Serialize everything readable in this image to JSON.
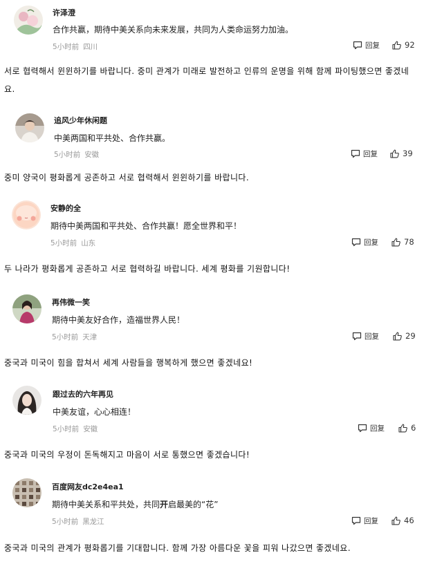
{
  "comments": [
    {
      "username": "许泽澄",
      "text": "合作共赢，期待中美关系向未来发展，共同为人类命运努力加油。",
      "time": "5小时前",
      "location": "四川",
      "reply_label": "回复",
      "likes": "92",
      "translation": "서로 협력해서 윈윈하기를 바랍니다. 중미 관계가 미래로 발전하고 인류의 운명을 위해 함께 파이팅했으면 좋겠네요."
    },
    {
      "username": "追风少年休闲题",
      "text": "中美两国和平共处、合作共赢。",
      "time": "5小时前",
      "location": "安徽",
      "reply_label": "回复",
      "likes": "39",
      "translation": "중미 양국이 평화롭게 공존하고 서로 협력해서 윈윈하기를 바랍니다."
    },
    {
      "username": "安静的全",
      "text": "期待中美两国和平共处、合作共赢！愿全世界和平！",
      "time": "5小时前",
      "location": "山东",
      "reply_label": "回复",
      "likes": "78",
      "translation": "두 나라가 평화롭게 공존하고 서로 협력하길 바랍니다. 세계 평화를 기원합니다!"
    },
    {
      "username": "再伟微一笑",
      "text": "期待中美友好合作，造福世界人民！",
      "time": "5小时前",
      "location": "天津",
      "reply_label": "回复",
      "likes": "29",
      "translation": "중국과 미국이 힘을 합쳐서 세계 사람들을 행복하게 했으면 좋겠네요!"
    },
    {
      "username": "跟过去的六年再见",
      "text": "中美友谊，心心相连！",
      "time": "5小时前",
      "location": "安徽",
      "reply_label": "回复",
      "likes": "6",
      "translation": "중국과 미국의 우정이 돈독해지고 마음이 서로 통했으면 좋겠습니다!"
    },
    {
      "username": "百度网友dc2e4ea1",
      "text_before": "期待中美关系和平共处，共同",
      "text_bold": "开",
      "text_after": "启最美的“花”",
      "time": "5小时前",
      "location": "黑龙江",
      "reply_label": "回复",
      "likes": "46",
      "translation": "중국과 미국의 관계가 평화롭기를 기대합니다. 함께 가장 아름다운 꽃을 피워 나갔으면 좋겠네요."
    }
  ],
  "icons": {
    "reply": "comment-bubble-icon",
    "like": "thumbs-up-icon"
  },
  "colors": {
    "meta_gray": "#999999",
    "text": "#222222"
  }
}
